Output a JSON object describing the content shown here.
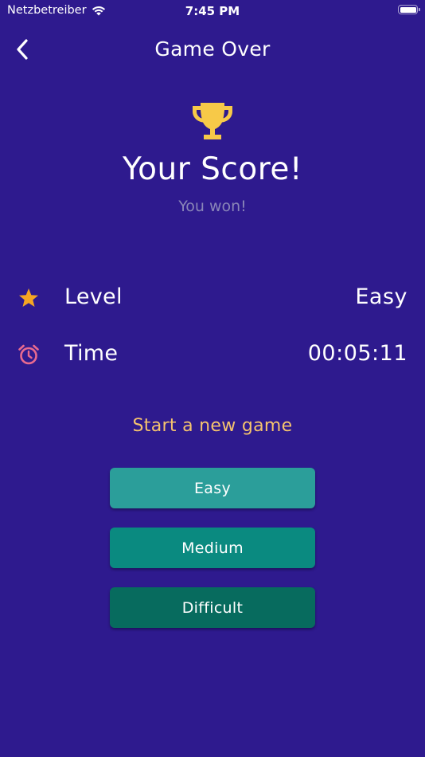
{
  "status_bar": {
    "carrier": "Netzbetreiber",
    "time": "7:45 PM",
    "wifi_icon": "wifi-icon",
    "battery_icon": "battery-icon"
  },
  "nav": {
    "title": "Game Over",
    "back_icon": "chevron-left-icon"
  },
  "hero": {
    "icon": "trophy-icon",
    "title": "Your Score!",
    "subtitle": "You won!"
  },
  "stats": {
    "level": {
      "icon": "star-icon",
      "label": "Level",
      "value": "Easy"
    },
    "time": {
      "icon": "alarm-clock-icon",
      "label": "Time",
      "value": "00:05:11"
    }
  },
  "new_game": {
    "heading": "Start a new game",
    "buttons": {
      "easy": "Easy",
      "medium": "Medium",
      "difficult": "Difficult"
    }
  },
  "colors": {
    "background": "#2e1a8e",
    "trophy": "#f7c948",
    "star": "#f5a623",
    "alarm": "#e86a8f",
    "heading_accent": "#f5c36e",
    "subtitle": "#8a86b8",
    "button_easy": "#2b9e9a",
    "button_medium": "#0a8a80",
    "button_difficult": "#076b5e"
  }
}
